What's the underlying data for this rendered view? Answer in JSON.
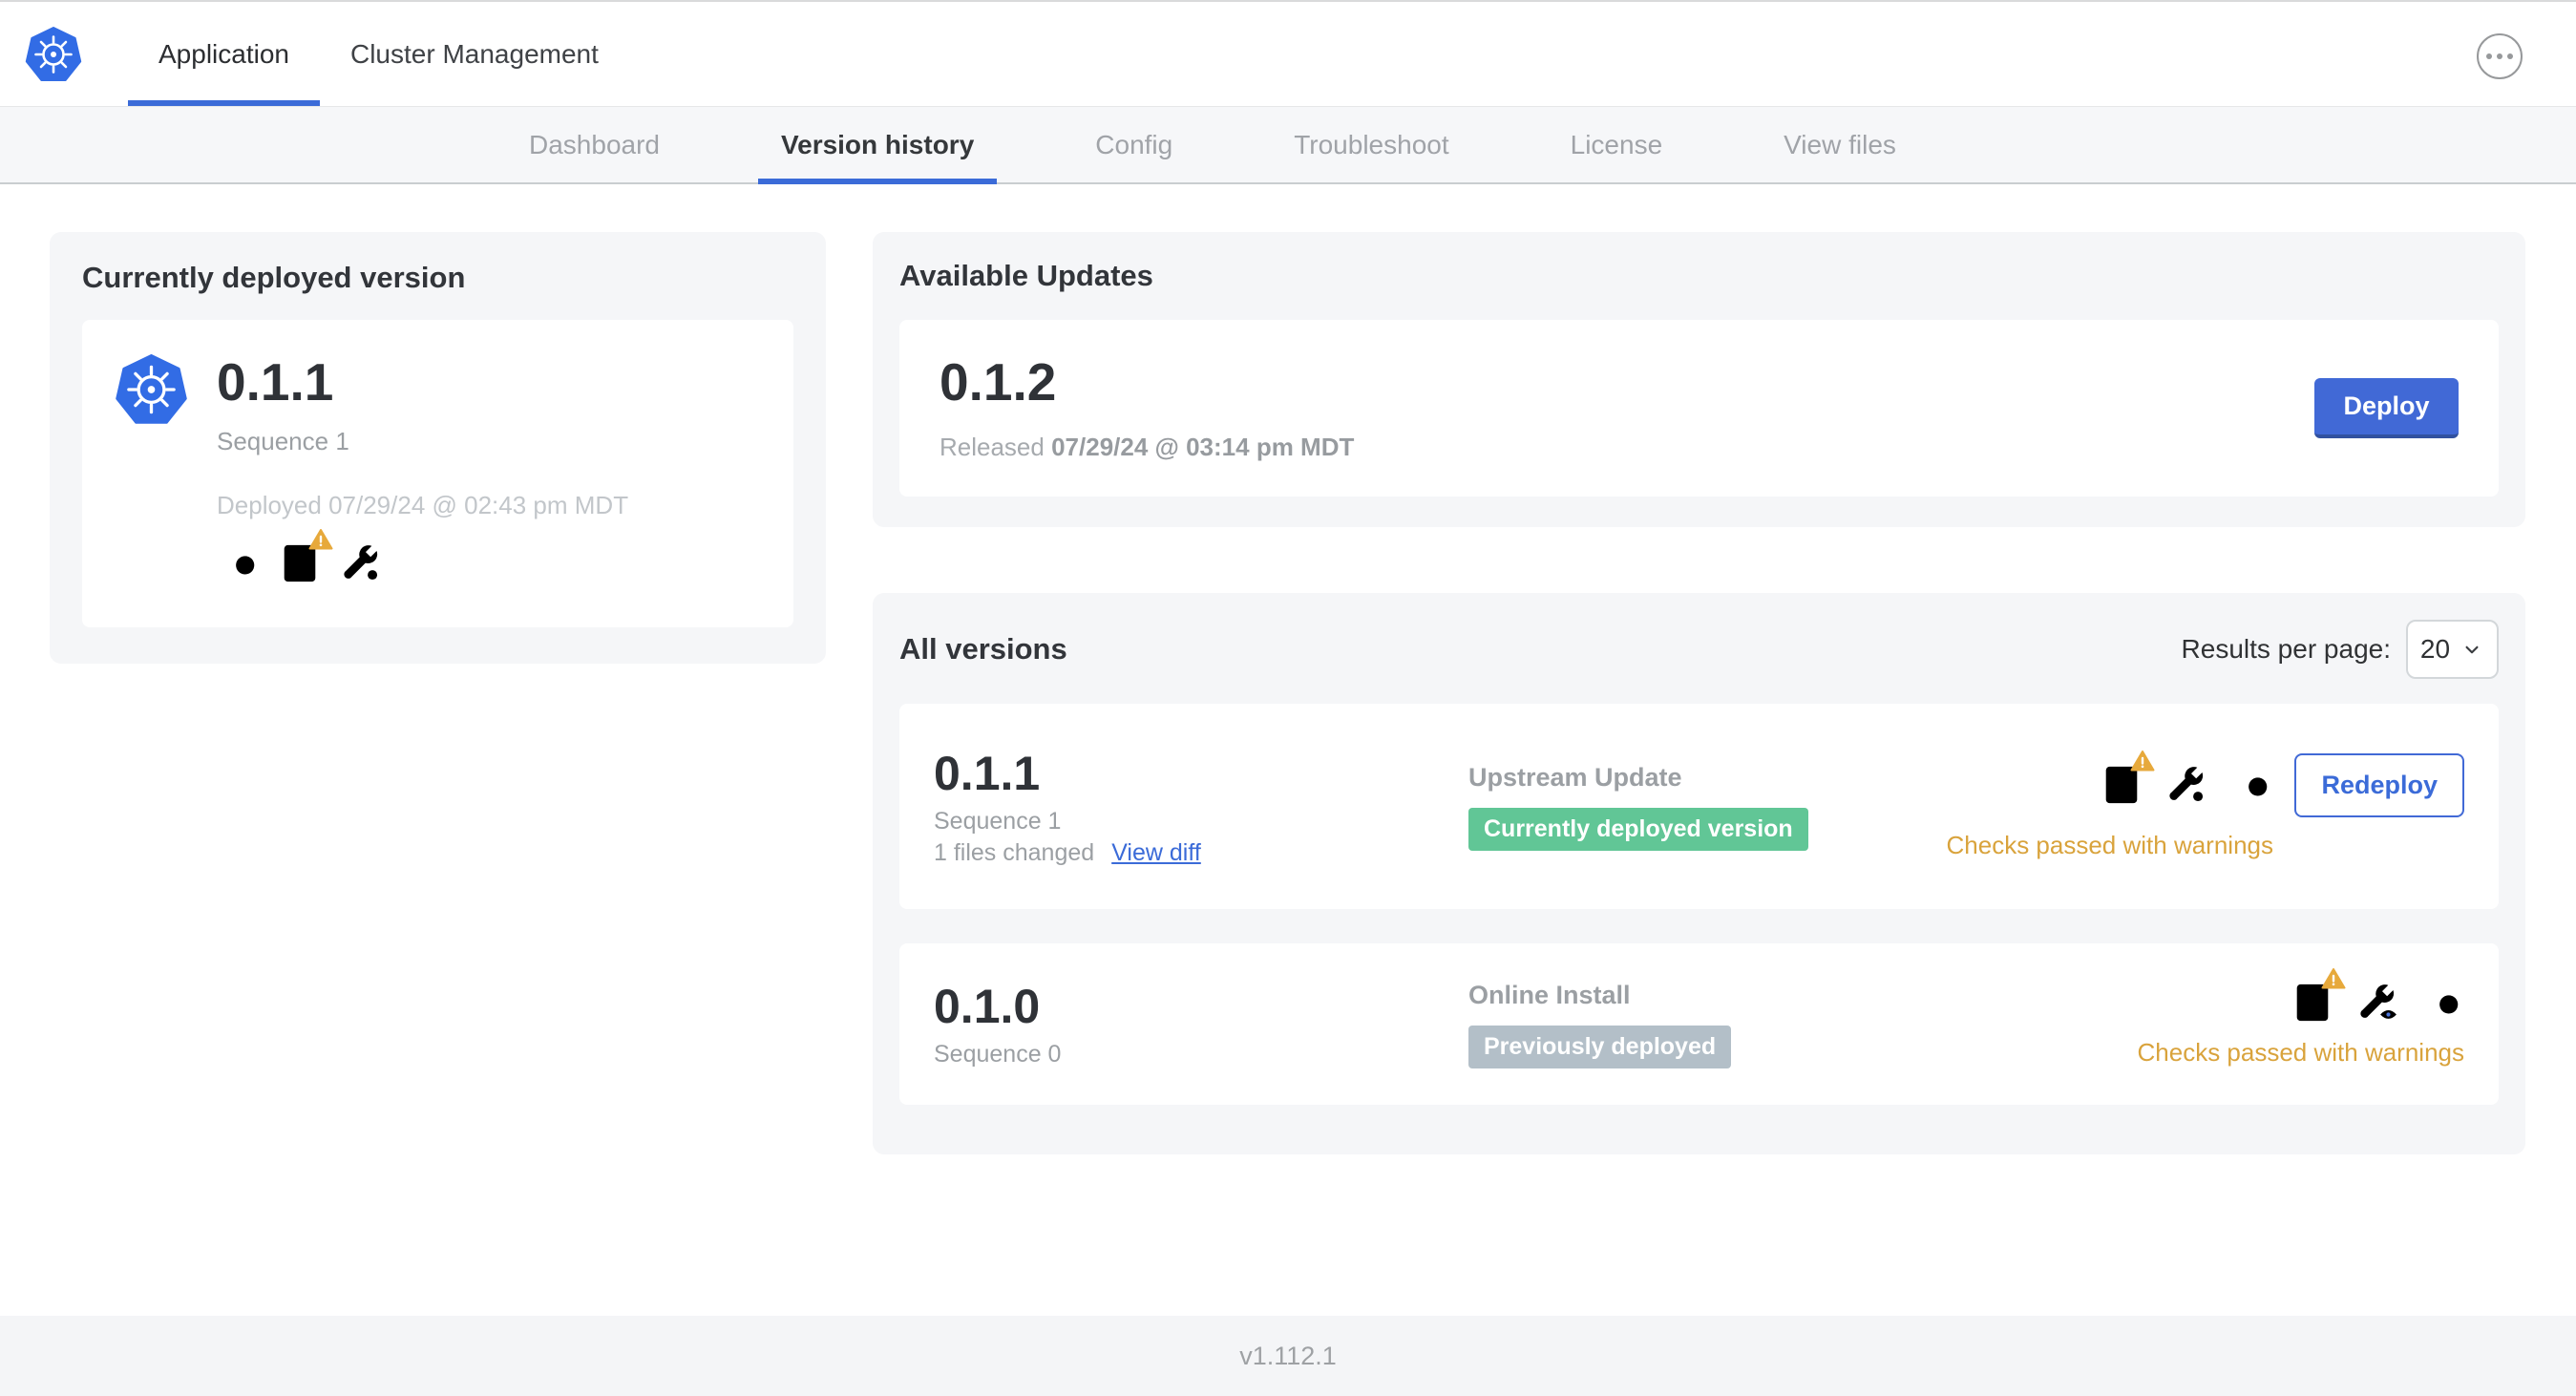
{
  "colors": {
    "accent_blue": "#3b6bd8",
    "button_blue": "#4169d6",
    "kubernetes_blue": "#326ce5",
    "success_green": "#61c696",
    "muted_gray_badge": "#b3bfc8",
    "warning_amber": "#d9a33c",
    "panel_gray": "#f5f6f8"
  },
  "header": {
    "logo_icon": "kubernetes-logo",
    "tabs": [
      {
        "label": "Application",
        "active": true
      },
      {
        "label": "Cluster Management",
        "active": false
      }
    ],
    "more_icon": "ellipsis-menu"
  },
  "subnav": {
    "items": [
      {
        "label": "Dashboard",
        "active": false
      },
      {
        "label": "Version history",
        "active": true
      },
      {
        "label": "Config",
        "active": false
      },
      {
        "label": "Troubleshoot",
        "active": false
      },
      {
        "label": "License",
        "active": false
      },
      {
        "label": "View files",
        "active": false
      }
    ]
  },
  "deployed": {
    "title": "Currently deployed version",
    "app_icon": "kubernetes-logo",
    "version": "0.1.1",
    "sequence": "Sequence 1",
    "deployed_at": "Deployed 07/29/24 @ 02:43 pm MDT",
    "icons": [
      "diff-icon",
      "preflight-checks-warning-icon",
      "config-edit-icon"
    ]
  },
  "updates": {
    "title": "Available Updates",
    "version": "0.1.2",
    "released_prefix": "Released",
    "released_at": "07/29/24 @ 03:14 pm MDT",
    "deploy_label": "Deploy"
  },
  "all_versions": {
    "title": "All versions",
    "results_per_page_label": "Results per page:",
    "results_per_page_value": "20",
    "rows": [
      {
        "version": "0.1.1",
        "sequence": "Sequence 1",
        "files_changed": "1 files changed",
        "view_diff_label": "View diff",
        "source": "Upstream Update",
        "badge": "Currently deployed version",
        "badge_type": "success",
        "icons": [
          "preflight-checks-warning-icon",
          "config-edit-icon",
          "diff-icon"
        ],
        "action_label": "Redeploy",
        "checks": "Checks passed with warnings"
      },
      {
        "version": "0.1.0",
        "sequence": "Sequence 0",
        "source": "Online Install",
        "badge": "Previously deployed",
        "badge_type": "muted",
        "icons": [
          "preflight-checks-warning-icon",
          "config-view-icon",
          "diff-icon"
        ],
        "checks": "Checks passed with warnings"
      }
    ]
  },
  "footer": {
    "app_version": "v1.112.1"
  }
}
